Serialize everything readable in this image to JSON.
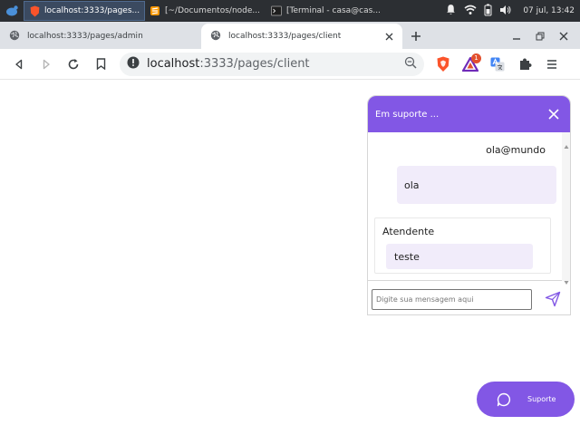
{
  "taskbar": {
    "tasks": [
      {
        "label": "localhost:3333/pages...",
        "icon": "brave-icon",
        "active": true
      },
      {
        "label": "[~/Documentos/node...",
        "icon": "sublime-icon",
        "active": false
      },
      {
        "label": "[Terminal - casa@cas...",
        "icon": "terminal-icon",
        "active": false
      }
    ],
    "clock": "07 jul, 13:42"
  },
  "browser": {
    "tabs": [
      {
        "label": "localhost:3333/pages/admin",
        "active": false
      },
      {
        "label": "localhost:3333/pages/client",
        "active": true
      }
    ],
    "url_host": "localhost",
    "url_rest": ":3333/pages/client",
    "extension_badge": "1"
  },
  "chat": {
    "title": "Em suporte ...",
    "user_name": "ola@mundo",
    "user_message": "ola",
    "agent_name": "Atendente",
    "agent_message": "teste",
    "input_placeholder": "Digite sua mensagem aqui",
    "input_value": ""
  },
  "support_button": {
    "label": "Suporte"
  },
  "colors": {
    "accent": "#8257e5",
    "bubble": "#f1ecfa"
  }
}
